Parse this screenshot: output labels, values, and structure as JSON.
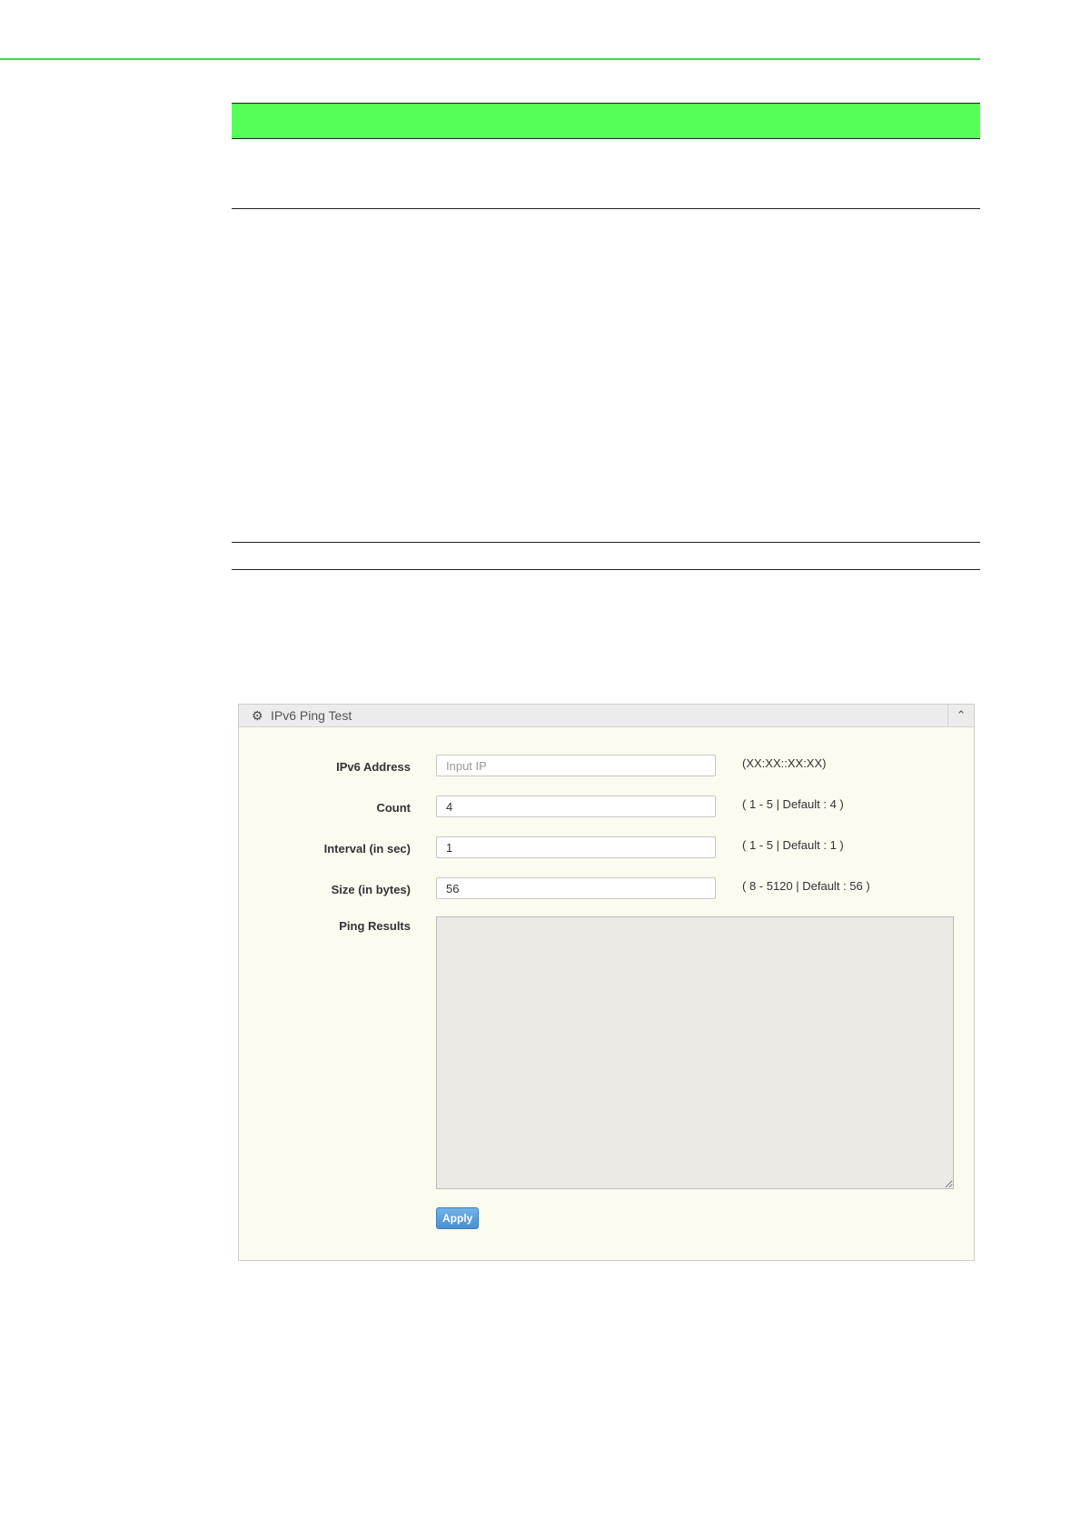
{
  "panel": {
    "title": "IPv6 Ping Test",
    "icon": "gear-icon",
    "collapse_icon": "chevron-up-icon"
  },
  "fields": {
    "ipv6_address": {
      "label": "IPv6 Address",
      "value": "",
      "placeholder": "Input IP",
      "hint": "(XX:XX::XX:XX)"
    },
    "count": {
      "label": "Count",
      "value": "4",
      "hint": "( 1 - 5 | Default : 4 )"
    },
    "interval": {
      "label": "Interval (in sec)",
      "value": "1",
      "hint": "( 1 - 5 | Default : 1 )"
    },
    "size": {
      "label": "Size (in bytes)",
      "value": "56",
      "hint": "( 8 - 5120 | Default : 56 )"
    },
    "ping_results": {
      "label": "Ping Results",
      "value": ""
    }
  },
  "actions": {
    "apply_label": "Apply"
  },
  "colors": {
    "header_band": "#55ff55",
    "top_rule": "#4cd04c",
    "panel_bg": "#fcfbf0",
    "results_bg": "#edeae6",
    "apply_button": "#4a8fd0"
  }
}
